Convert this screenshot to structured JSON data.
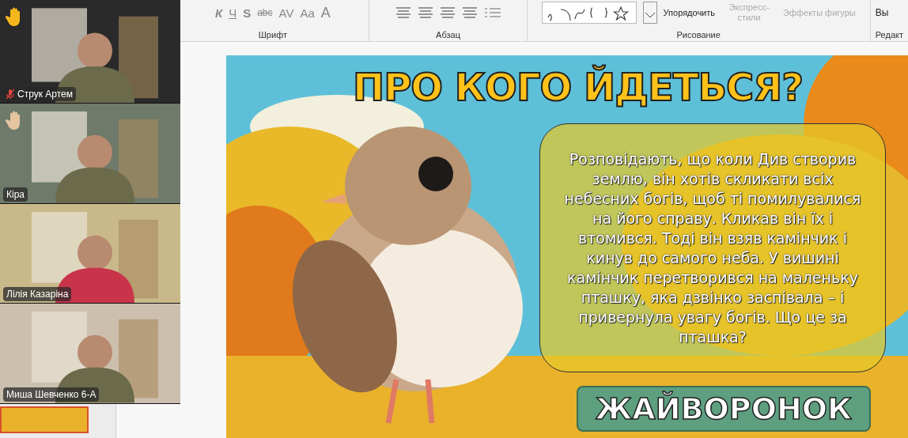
{
  "ribbon": {
    "font_group": {
      "label": "Шрифт",
      "buttons": [
        "К",
        "Ч",
        "S",
        "abc",
        "AV",
        "Aa",
        "A"
      ]
    },
    "paragraph_group": {
      "label": "Абзац"
    },
    "drawing_group": {
      "label": "Рисование",
      "arrange": "Упорядочить",
      "quick_styles": "Экспресс-стили",
      "effects": "Эффекты фигуры"
    },
    "editing_group": {
      "label": "Редакт",
      "select": "Вы"
    }
  },
  "participants": [
    {
      "name": "Струк Артем",
      "hand_raised": true,
      "muted": true
    },
    {
      "name": "Кіра",
      "hand_raised": true,
      "muted": false
    },
    {
      "name": "Лілія Казаріна",
      "hand_raised": false,
      "muted": false
    },
    {
      "name": "Миша Шевченко 6-А",
      "hand_raised": false,
      "muted": false
    }
  ],
  "slide": {
    "title": "ПРО КОГО ЙДЕТЬСЯ?",
    "text": "Розповідають, що коли Див створив землю, він хотів скликати всіх небесних богів, щоб ті помилувалися на його справу. Кликав він їх і втомився. Тоді він взяв камінчик і кинув до самого неба. У вишині камінчик перетворився на маленьку пташку, яка дзвінко заспівала – і привернула увагу богів. Що це за пташка?",
    "answer": "ЖАЙВОРОНОК"
  }
}
